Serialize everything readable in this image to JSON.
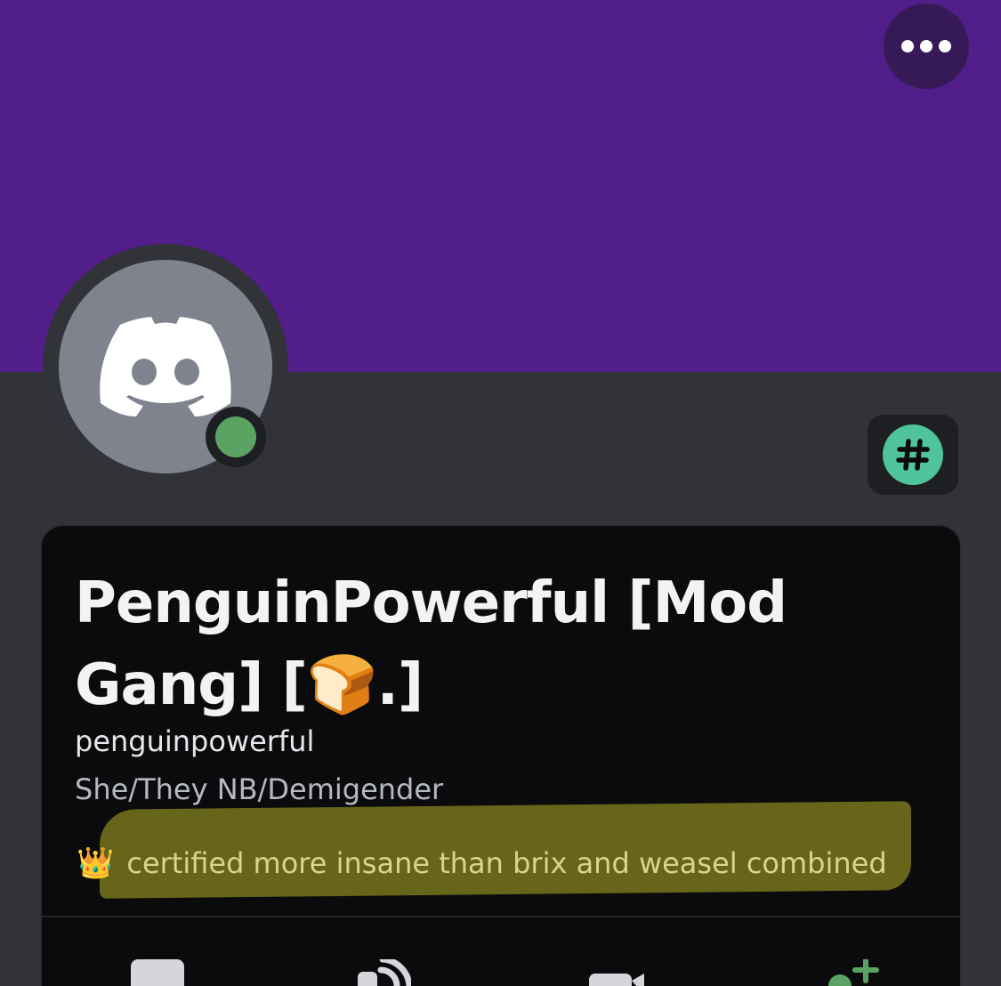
{
  "profile": {
    "display_name": "PenguinPowerful [Mod Gang] [🍞.]",
    "username": "penguinpowerful",
    "pronouns": "She/They NB/Demigender",
    "status_emoji": "👑",
    "status_text": "certified more insane than brix and weasel combined"
  },
  "icons": {
    "more": "more-horizontal-icon",
    "avatar": "discord-logo-icon",
    "badge": "hash-badge-icon",
    "actions": [
      "message-icon",
      "voice-call-icon",
      "video-call-icon",
      "add-friend-icon"
    ]
  },
  "colors": {
    "banner": "#521e8a",
    "background": "#313338",
    "card": "#0b0b0d",
    "online": "#5aa363",
    "badge": "#4fc39a",
    "highlight": "#6b6a1a"
  }
}
